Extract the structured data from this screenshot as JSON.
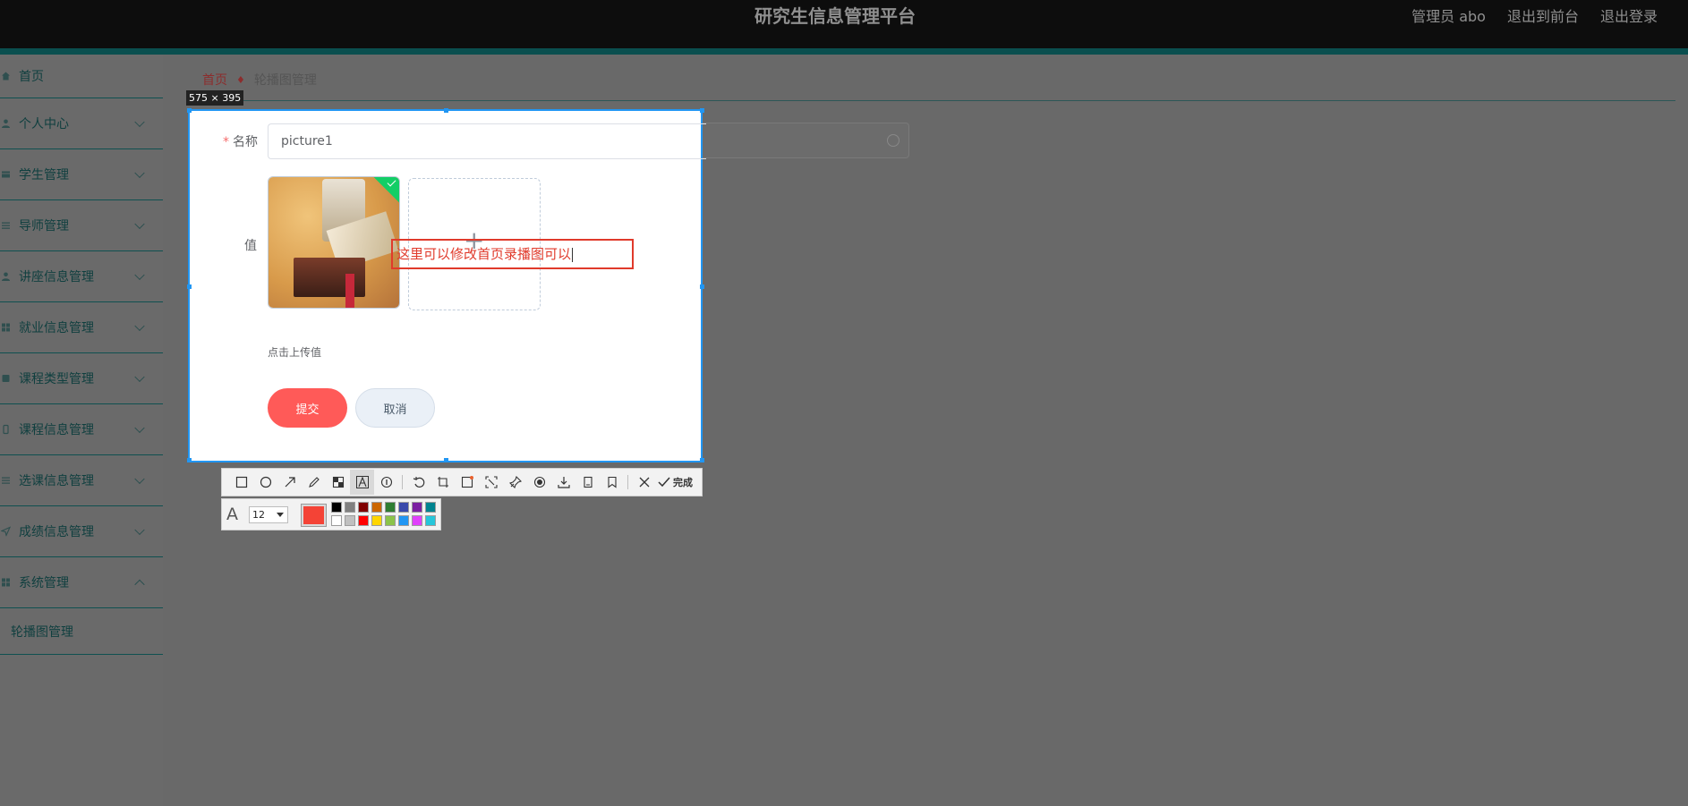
{
  "header": {
    "title": "研究生信息管理平台",
    "admin_label": "管理员 abo",
    "front_link": "退出到前台",
    "logout_link": "退出登录"
  },
  "sidebar": {
    "items": [
      {
        "label": "首页",
        "icon": "home-icon"
      },
      {
        "label": "个人中心",
        "icon": "user-icon"
      },
      {
        "label": "学生管理",
        "icon": "folder-icon"
      },
      {
        "label": "导师管理",
        "icon": "sliders-icon"
      },
      {
        "label": "讲座信息管理",
        "icon": "user-icon"
      },
      {
        "label": "就业信息管理",
        "icon": "grid-icon"
      },
      {
        "label": "课程类型管理",
        "icon": "book-icon"
      },
      {
        "label": "课程信息管理",
        "icon": "mobile-icon"
      },
      {
        "label": "选课信息管理",
        "icon": "list-icon"
      },
      {
        "label": "成绩信息管理",
        "icon": "send-icon"
      },
      {
        "label": "系统管理",
        "icon": "grid-icon"
      }
    ],
    "sub_item": "轮播图管理"
  },
  "breadcrumb": {
    "home": "首页",
    "current": "轮播图管理"
  },
  "capture": {
    "size_label": "575 × 395"
  },
  "form": {
    "name_label": "名称",
    "name_value": "picture1",
    "value_label": "值",
    "upload_tip": "点击上传值",
    "submit": "提交",
    "cancel": "取消"
  },
  "annotation": {
    "text": "这里可以修改首页录播图可以"
  },
  "toolbar": {
    "tools": [
      "rectangle-icon",
      "ellipse-icon",
      "arrow-icon",
      "pencil-icon",
      "mosaic-icon",
      "text-icon",
      "serial-number-icon",
      "undo-icon",
      "crop-icon",
      "ocr-icon",
      "scroll-capture-icon",
      "pin-icon",
      "record-icon",
      "save-icon",
      "copy-icon",
      "bookmark-icon",
      "close-icon"
    ],
    "done_label": "完成",
    "font_size": "12",
    "current_color": "#f44336",
    "palette": [
      "#000000",
      "#808080",
      "#800000",
      "#cc6600",
      "#2e7d32",
      "#3949ab",
      "#7b1fa2",
      "#00838f",
      "#ffffff",
      "#c0c0c0",
      "#ff0000",
      "#ffd600",
      "#8bc34a",
      "#2196f3",
      "#e040fb",
      "#26c6da"
    ]
  }
}
